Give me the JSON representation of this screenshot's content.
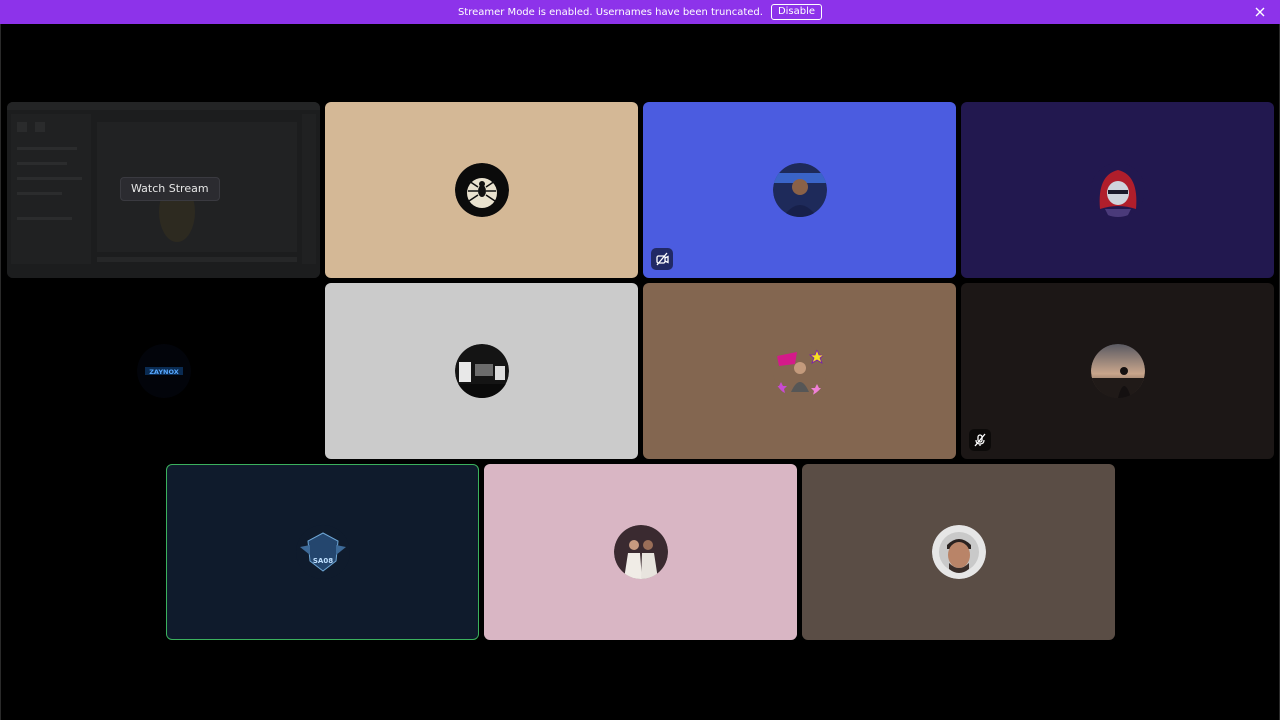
{
  "banner": {
    "message": "Streamer Mode is enabled. Usernames have been truncated.",
    "disable_label": "Disable",
    "close_icon": "close-icon",
    "color": "#8d33ea"
  },
  "stream_tile": {
    "watch_label": "Watch Stream"
  },
  "tiles": [
    {
      "background": "#d4b896",
      "avatar": "spider-avatar"
    },
    {
      "background": "#4b5ce0",
      "avatar": "person-avatar",
      "badge": "camera-off-icon"
    },
    {
      "background": "#22184f",
      "avatar": "hooded-avatar"
    },
    {
      "background": "#000000",
      "avatar": "zaynox-logo",
      "avatar_text": "ZAYNOX"
    },
    {
      "background": "#cbcbcb",
      "avatar": "room-avatar"
    },
    {
      "background": "#836650",
      "avatar": "sticker-avatar"
    },
    {
      "background": "#1c1716",
      "avatar": "sunset-avatar",
      "badge": "mic-off-icon"
    },
    {
      "background": "#0f1b2c",
      "avatar": "sa08-logo",
      "avatar_text": "SA08",
      "selected": true,
      "border_color": "#3bb15d"
    },
    {
      "background": "#d9b6c4",
      "avatar": "couple-avatar"
    },
    {
      "background": "#5a4d45",
      "avatar": "man-portrait-avatar"
    }
  ]
}
